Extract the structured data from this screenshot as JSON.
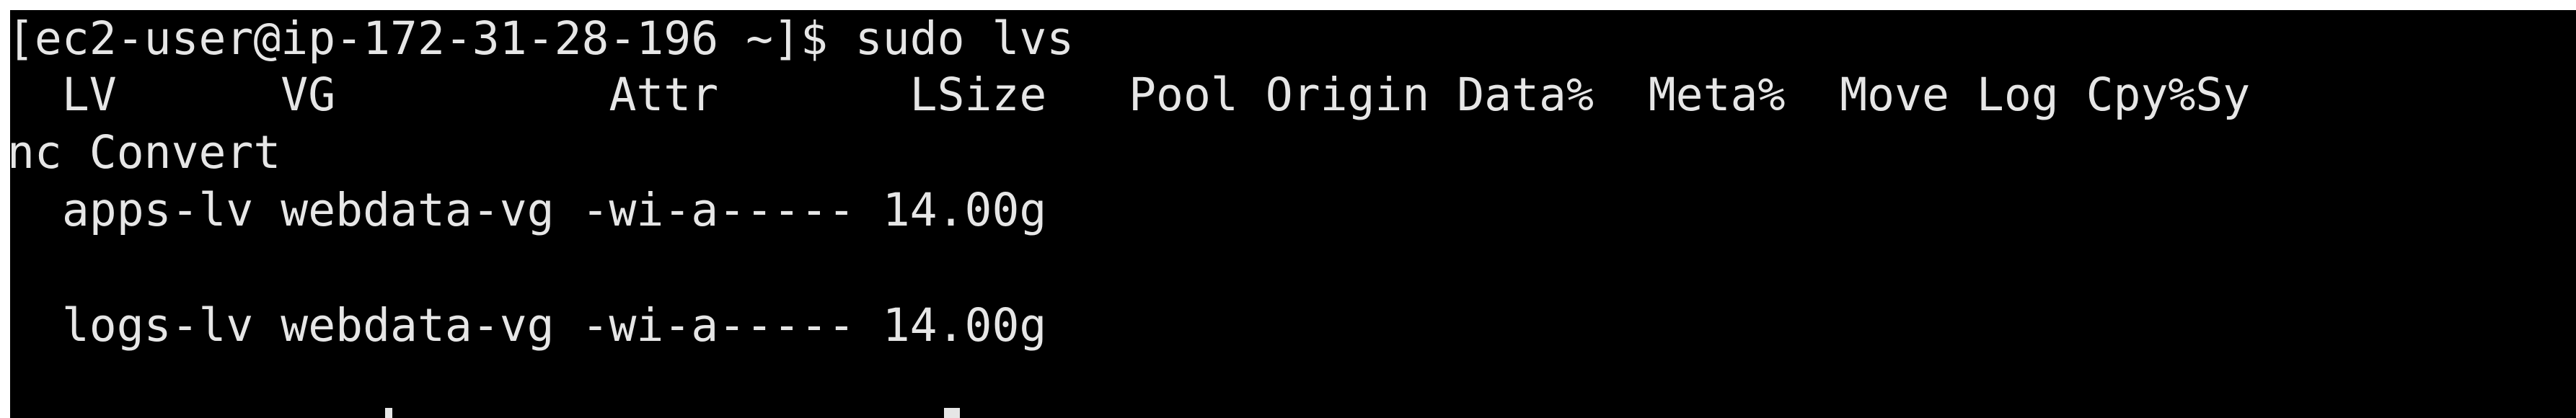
{
  "terminal": {
    "prompt_line": "[ec2-user@ip-172-31-28-196 ~]$ sudo lvs",
    "header_line": "  LV      VG          Attr       LSize   Pool Origin Data%  Meta%  Move Log Cpy%Sy",
    "header_wrap": "nc Convert",
    "rows": [
      "  apps-lv webdata-vg -wi-a----- 14.00g",
      "  logs-lv webdata-vg -wi-a----- 14.00g"
    ]
  },
  "colors": {
    "background": "#000000",
    "text": "#e6e6e6"
  }
}
